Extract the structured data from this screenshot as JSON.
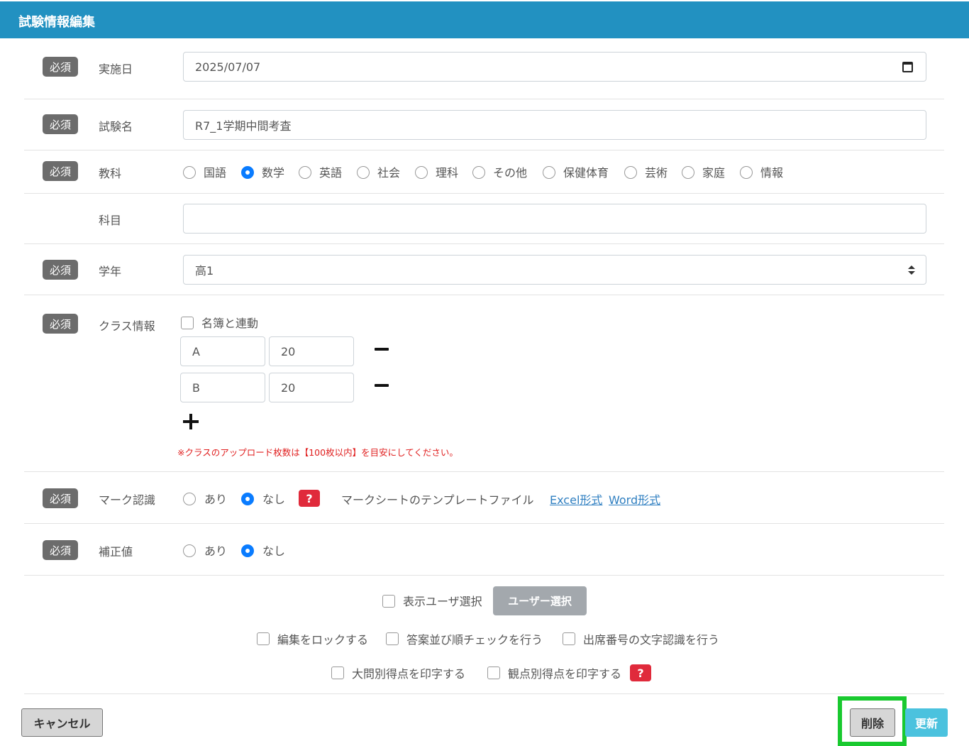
{
  "header": {
    "title": "試験情報編集"
  },
  "required_label": "必須",
  "fields": {
    "date": {
      "label": "実施日",
      "value": "2025/07/07"
    },
    "exam_name": {
      "label": "試験名",
      "value": "R7_1学期中間考査"
    },
    "subject_category": {
      "label": "教科",
      "options": [
        "国語",
        "数学",
        "英語",
        "社会",
        "理科",
        "その他",
        "保健体育",
        "芸術",
        "家庭",
        "情報"
      ],
      "selected": "数学"
    },
    "subject": {
      "label": "科目",
      "value": ""
    },
    "grade": {
      "label": "学年",
      "value": "高1"
    },
    "class_info": {
      "label": "クラス情報",
      "link_roster_label": "名簿と連動",
      "rows": [
        {
          "name": "A",
          "count": "20"
        },
        {
          "name": "B",
          "count": "20"
        }
      ],
      "note": "※クラスのアップロード枚数は【100枚以内】を目安にしてください。"
    },
    "mark_recognition": {
      "label": "マーク認識",
      "options": [
        "あり",
        "なし"
      ],
      "selected": "なし",
      "help": "?",
      "template_label": "マークシートのテンプレートファイル",
      "excel_link": "Excel形式",
      "word_link": "Word形式"
    },
    "correction": {
      "label": "補正値",
      "options": [
        "あり",
        "なし"
      ],
      "selected": "なし"
    }
  },
  "options": {
    "display_user_label": "表示ユーザ選択",
    "user_select_button": "ユーザー選択",
    "lock_edit": "編集をロックする",
    "answer_order_check": "答案並び順チェックを行う",
    "attendance_ocr": "出席番号の文字認識を行う",
    "print_major_scores": "大問別得点を印字する",
    "print_viewpoint_scores": "観点別得点を印字する",
    "help": "?"
  },
  "buttons": {
    "cancel": "キャンセル",
    "delete": "削除",
    "update": "更新"
  },
  "colors": {
    "header": "#2291c1",
    "radio_selected": "#0a7cff",
    "help": "#e02a3b",
    "update": "#4bc2de",
    "highlight": "#19c92f"
  }
}
